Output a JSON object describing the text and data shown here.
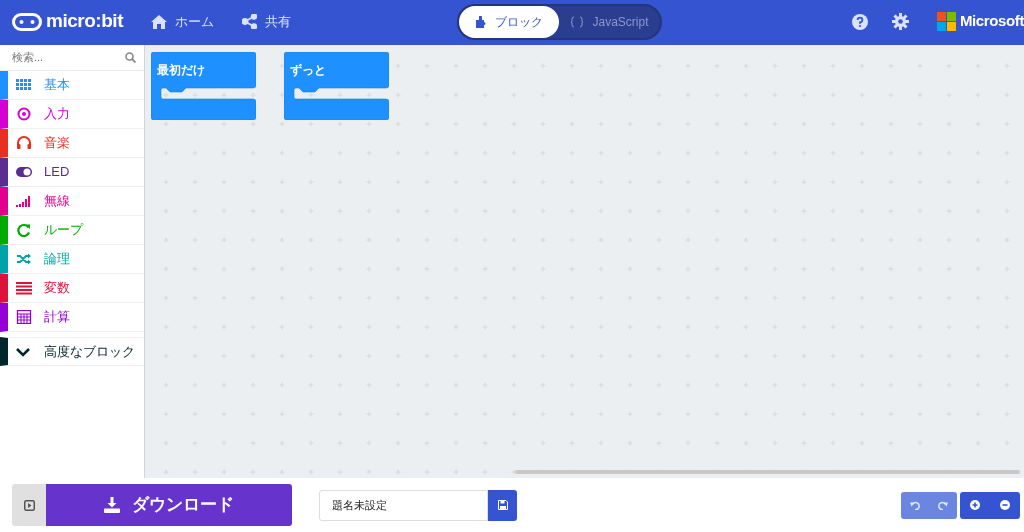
{
  "header": {
    "logo": "micro:bit",
    "nav": [
      {
        "label": "ホーム",
        "kind": "home"
      },
      {
        "label": "共有",
        "kind": "share"
      }
    ],
    "tabs": [
      {
        "label": "ブロック",
        "kind": "blocks",
        "selected": true
      },
      {
        "label": "JavaScript",
        "kind": "code",
        "selected": false
      }
    ],
    "brand": "Microsoft"
  },
  "sidebar": {
    "search": {
      "placeholder": "検索..."
    },
    "categories": [
      {
        "label": "基本",
        "kind": "grid",
        "color": "#1e90ff"
      },
      {
        "label": "入力",
        "kind": "target",
        "color": "#d400d4"
      },
      {
        "label": "音楽",
        "kind": "headphones",
        "color": "#e63022"
      },
      {
        "label": "LED",
        "kind": "toggle",
        "color": "#5c2d91"
      },
      {
        "label": "無線",
        "kind": "signal",
        "color": "#e3008c"
      },
      {
        "label": "ループ",
        "kind": "loop",
        "color": "#00aa00"
      },
      {
        "label": "論理",
        "kind": "shuffle",
        "color": "#00a4a6"
      },
      {
        "label": "変数",
        "kind": "lines",
        "color": "#dc143c"
      },
      {
        "label": "計算",
        "kind": "calculator",
        "color": "#9400d3"
      }
    ],
    "advanced": {
      "label": "高度なブロック",
      "expanded": false,
      "color": "#00272b"
    }
  },
  "workspace": {
    "blocks": [
      {
        "label": "最初だけ"
      },
      {
        "label": "ずっと"
      }
    ]
  },
  "footer": {
    "download": "ダウンロード",
    "project_name": "題名未設定"
  }
}
